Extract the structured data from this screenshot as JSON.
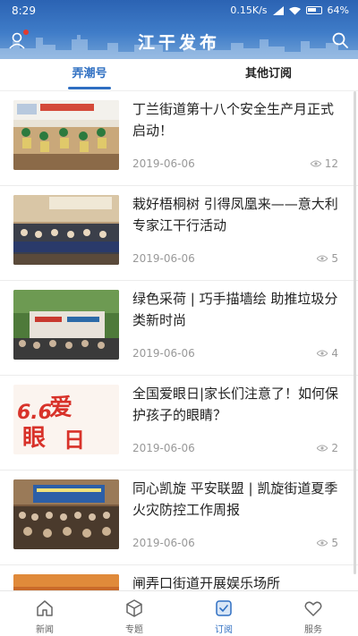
{
  "status": {
    "time": "8:29",
    "speed": "0.15K/s",
    "battery": "64%"
  },
  "header": {
    "title": "江干发布"
  },
  "tabs": [
    {
      "label": "弄潮号",
      "active": true
    },
    {
      "label": "其他订阅",
      "active": false
    }
  ],
  "articles": [
    {
      "title": "丁兰街道第十八个安全生产月正式启动！",
      "date": "2019-06-06",
      "views": "12"
    },
    {
      "title": "栽好梧桐树 引得凤凰来——意大利专家江干行活动",
      "date": "2019-06-06",
      "views": "5"
    },
    {
      "title": "绿色采荷 | 巧手描墙绘 助推垃圾分类新时尚",
      "date": "2019-06-06",
      "views": "4"
    },
    {
      "title": "全国爱眼日|家长们注意了！如何保护孩子的眼睛？",
      "date": "2019-06-06",
      "views": "2"
    },
    {
      "title": "同心凯旋 平安联盟 | 凯旋街道夏季火灾防控工作周报",
      "date": "2019-06-06",
      "views": "5"
    },
    {
      "title": "闸弄口街道开展娱乐场所",
      "date": "",
      "views": ""
    }
  ],
  "thumb4": {
    "line1": "6.6",
    "line2": "眼",
    "line3": "爱",
    "line4": "日"
  },
  "nav": [
    {
      "label": "新闻",
      "icon": "home-icon",
      "active": false
    },
    {
      "label": "专题",
      "icon": "cube-icon",
      "active": false
    },
    {
      "label": "订阅",
      "icon": "subscribe-icon",
      "active": true
    },
    {
      "label": "服务",
      "icon": "heart-icon",
      "active": false
    }
  ],
  "colors": {
    "accent": "#2f6fc2",
    "header": "#3f7cc8"
  }
}
